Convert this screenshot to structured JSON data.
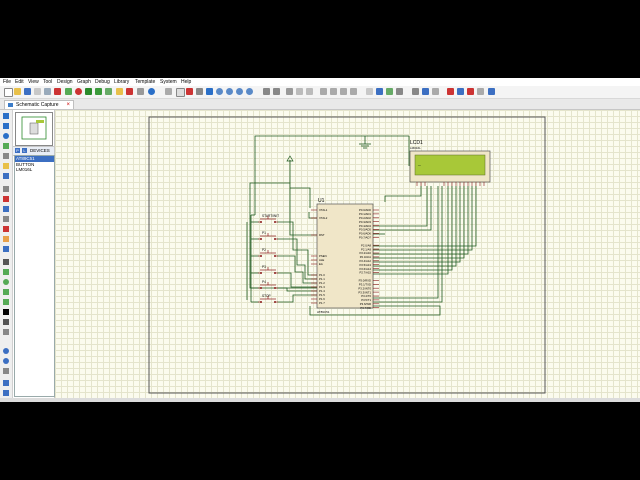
{
  "menu": [
    "File",
    "Edit",
    "View",
    "Tool",
    "Design",
    "Graph",
    "Debug",
    "Library",
    "Template",
    "System",
    "Help"
  ],
  "tab": {
    "label": "Schematic Capture",
    "close": "×"
  },
  "panel": {
    "btn_p": "P",
    "btn_l": "L",
    "header": "DEVICES",
    "devices": [
      "AT89C51",
      "BUTTON",
      "LM016L"
    ],
    "selected": 0
  },
  "schematic": {
    "lcd": {
      "ref": "LCD1",
      "part": "LM016L",
      "screen_text": "_"
    },
    "mcu": {
      "ref": "U1",
      "part": "AT89C51",
      "left_pins": [
        "XTAL1",
        "XTAL2",
        "RST",
        "PSEN",
        "ALE",
        "EA",
        "P1.0",
        "P1.1",
        "P1.2",
        "P1.3",
        "P1.4",
        "P1.5",
        "P1.6",
        "P1.7"
      ],
      "right_pins": [
        "P0.0/AD0",
        "P0.1/AD1",
        "P0.2/AD2",
        "P0.3/AD3",
        "P0.4/AD4",
        "P0.5/AD5",
        "P0.6/AD6",
        "P0.7/AD7",
        "P2.0/A8",
        "P2.1/A9",
        "P2.2/A10",
        "P2.3/A11",
        "P2.4/A12",
        "P2.5/A13",
        "P2.6/A14",
        "P2.7/A15",
        "P3.0/RXD",
        "P3.1/TXD",
        "P3.2/INT0",
        "P3.3/INT1",
        "P3.4/T0",
        "P3.5/T1",
        "P3.6/WR",
        "P3.7/RD"
      ]
    },
    "buttons": [
      "START/INIT",
      "P1",
      "P2",
      "P3",
      "P4",
      "STOP"
    ]
  },
  "colors": {
    "wire": "#1e5a1e",
    "component": "#8b1a1a",
    "body": "#f0e6c8",
    "lcd_screen": "#a8c838",
    "sheet_border": "#555555"
  }
}
